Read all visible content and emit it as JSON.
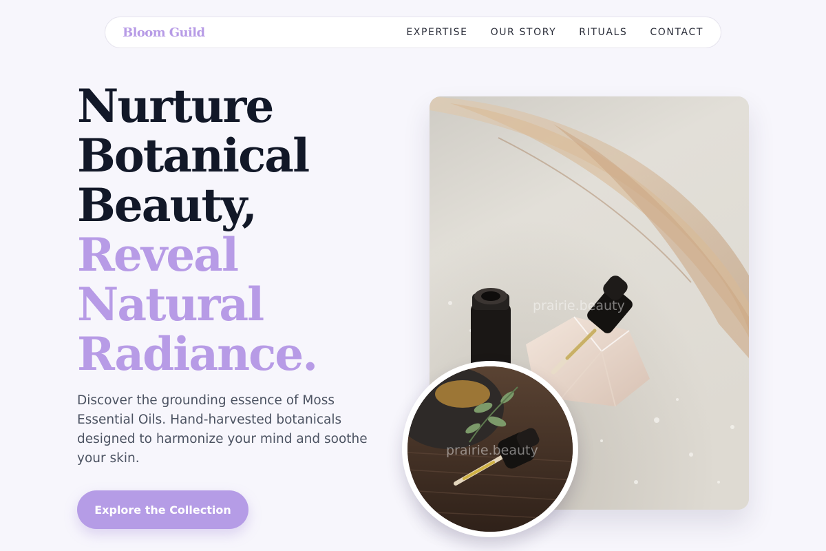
{
  "nav": {
    "brand": "Bloom Guild",
    "links": [
      "EXPERTISE",
      "OUR STORY",
      "RITUALS",
      "CONTACT"
    ]
  },
  "hero": {
    "headline_dark": [
      "Nurture",
      "Botanical",
      "Beauty,"
    ],
    "headline_accent": [
      "Reveal",
      "Natural",
      "Radiance."
    ],
    "description": "Discover the grounding essence of Moss Essential Oils. Hand-harvested botanicals designed to harmonize your mind and soothe your skin.",
    "cta_label": "Explore the Collection"
  },
  "images": {
    "main_watermark": "prairie.beauty",
    "inset_watermark": "prairie.beauty"
  },
  "colors": {
    "accent": "#b79be6",
    "headline": "#121828",
    "background": "#f7f6fc",
    "cta": "#b59ce6"
  }
}
